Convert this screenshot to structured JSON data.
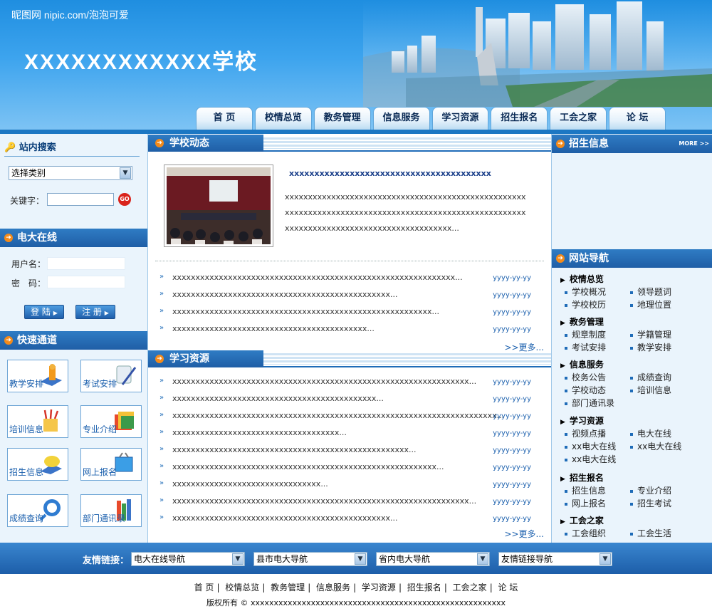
{
  "header": {
    "watermark": "昵图网 nipic.com/泡泡可爱",
    "title": "XXXXXXXXXXXX学校"
  },
  "nav": [
    "首 页",
    "校情总览",
    "教务管理",
    "信息服务",
    "学习资源",
    "招生报名",
    "工会之家",
    "论 坛"
  ],
  "left": {
    "search_title": "站内搜索",
    "category_select": "选择类别",
    "keyword_label": "关键字：",
    "go_label": "GO",
    "login_title": "电大在线",
    "username_label": "用户名：",
    "password_label": "密　码：",
    "login_btn": "登 陆",
    "register_btn": "注 册",
    "quick_title": "快速通道",
    "quick": [
      "教学安排",
      "考试安排",
      "培训信息",
      "专业介绍",
      "招生信息",
      "网上报名",
      "成绩查询",
      "部门通讯录"
    ]
  },
  "news": {
    "title": "学校动态",
    "headline": "xxxxxxxxxxxxxxxxxxxxxxxxxxxxxxxxxxxxxxxx",
    "para": [
      "xxxxxxxxxxxxxxxxxxxxxxxxxxxxxxxxxxxxxxxxxxxxxxxxxxxx",
      "xxxxxxxxxxxxxxxxxxxxxxxxxxxxxxxxxxxxxxxxxxxxxxxxxxxx",
      "xxxxxxxxxxxxxxxxxxxxxxxxxxxxxxxxxxxx..."
    ],
    "items": [
      {
        "t": "xxxxxxxxxxxxxxxxxxxxxxxxxxxxxxxxxxxxxxxxxxxxxxxxxxxxxxxxxxxxx...",
        "d": "yyyy-yy-yy"
      },
      {
        "t": "xxxxxxxxxxxxxxxxxxxxxxxxxxxxxxxxxxxxxxxxxxxxxxx...",
        "d": "yyyy-yy-yy"
      },
      {
        "t": "xxxxxxxxxxxxxxxxxxxxxxxxxxxxxxxxxxxxxxxxxxxxxxxxxxxxxxxx...",
        "d": "yyyy-yy-yy"
      },
      {
        "t": "xxxxxxxxxxxxxxxxxxxxxxxxxxxxxxxxxxxxxxxxxx...",
        "d": "yyyy-yy-yy"
      }
    ],
    "more": ">>更多..."
  },
  "study": {
    "title": "学习资源",
    "items": [
      {
        "t": "xxxxxxxxxxxxxxxxxxxxxxxxxxxxxxxxxxxxxxxxxxxxxxxxxxxxxxxxxxxxxxxx...",
        "d": "yyyy-yy-yy"
      },
      {
        "t": "xxxxxxxxxxxxxxxxxxxxxxxxxxxxxxxxxxxxxxxxxxxx...",
        "d": "yyyy-yy-yy"
      },
      {
        "t": "xxxxxxxxxxxxxxxxxxxxxxxxxxxxxxxxxxxxxxxxxxxxxxxxxxxxxxxxxxxxxxxxxxxxxx...",
        "d": "yyyy-yy-yy"
      },
      {
        "t": "xxxxxxxxxxxxxxxxxxxxxxxxxxxxxxxxxxxx...",
        "d": "yyyy-yy-yy"
      },
      {
        "t": "xxxxxxxxxxxxxxxxxxxxxxxxxxxxxxxxxxxxxxxxxxxxxxxxxxx...",
        "d": "yyyy-yy-yy"
      },
      {
        "t": "xxxxxxxxxxxxxxxxxxxxxxxxxxxxxxxxxxxxxxxxxxxxxxxxxxxxxxxxx...",
        "d": "yyyy-yy-yy"
      },
      {
        "t": "xxxxxxxxxxxxxxxxxxxxxxxxxxxxxxxx...",
        "d": "yyyy-yy-yy"
      },
      {
        "t": "xxxxxxxxxxxxxxxxxxxxxxxxxxxxxxxxxxxxxxxxxxxxxxxxxxxxxxxxxxxxxxxx...",
        "d": "yyyy-yy-yy"
      },
      {
        "t": "xxxxxxxxxxxxxxxxxxxxxxxxxxxxxxxxxxxxxxxxxxxxxxx...",
        "d": "yyyy-yy-yy"
      }
    ],
    "more": ">>更多..."
  },
  "right": {
    "enroll_title": "招生信息",
    "more": "MORE >>",
    "nav_title": "网站导航",
    "groups": [
      {
        "h": "校情总览",
        "items": [
          "学校概况",
          "领导题词",
          "学校校历",
          "地理位置"
        ]
      },
      {
        "h": "教务管理",
        "items": [
          "规章制度",
          "学籍管理",
          "考试安排",
          "教学安排"
        ]
      },
      {
        "h": "信息服务",
        "items": [
          "校务公告",
          "成绩查询",
          "学校动态",
          "培训信息",
          "部门通讯录"
        ]
      },
      {
        "h": "学习资源",
        "items": [
          "视频点播",
          "电大在线",
          "xx电大在线",
          "xx电大在线",
          "xx电大在线"
        ]
      },
      {
        "h": "招生报名",
        "items": [
          "招生信息",
          "专业介绍",
          "网上报名",
          "招生考试"
        ]
      },
      {
        "h": "工会之家",
        "items": [
          "工会组织",
          "工会生活"
        ]
      }
    ]
  },
  "links": {
    "label": "友情链接：",
    "selects": [
      "电大在线导航",
      "县市电大导航",
      "省内电大导航",
      "友情链接导航"
    ]
  },
  "footer": {
    "nav": [
      "首 页",
      "校情总览",
      "教务管理",
      "信息服务",
      "学习资源",
      "招生报名",
      "工会之家",
      "论 坛"
    ],
    "copyright": "版权所有 © xxxxxxxxxxxxxxxxxxxxxxxxxxxxxxxxxxxxxxxxxxxxxxxxxxxxxxx"
  },
  "colors": {
    "brand_blue": "#1f5ea6",
    "accent_orange": "#f38a1a",
    "header_sky": "#3da4ee"
  }
}
